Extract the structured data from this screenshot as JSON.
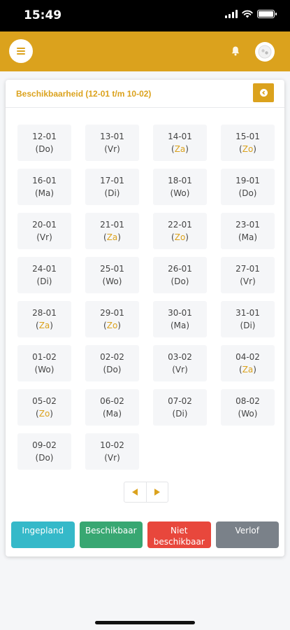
{
  "status_bar": {
    "time": "15:49"
  },
  "header": {
    "menu_icon": "hamburger-icon",
    "bell_icon": "bell-icon",
    "avatar_icon": "avatar-icon"
  },
  "card": {
    "title": "Beschikbaarheid (12-01 t/m 10-02)",
    "collapse_icon": "chevron-left-circle-icon"
  },
  "days": [
    {
      "date": "12-01",
      "weekday": "Do",
      "weekend": false
    },
    {
      "date": "13-01",
      "weekday": "Vr",
      "weekend": false
    },
    {
      "date": "14-01",
      "weekday": "Za",
      "weekend": true
    },
    {
      "date": "15-01",
      "weekday": "Zo",
      "weekend": true
    },
    {
      "date": "16-01",
      "weekday": "Ma",
      "weekend": false
    },
    {
      "date": "17-01",
      "weekday": "Di",
      "weekend": false
    },
    {
      "date": "18-01",
      "weekday": "Wo",
      "weekend": false
    },
    {
      "date": "19-01",
      "weekday": "Do",
      "weekend": false
    },
    {
      "date": "20-01",
      "weekday": "Vr",
      "weekend": false
    },
    {
      "date": "21-01",
      "weekday": "Za",
      "weekend": true
    },
    {
      "date": "22-01",
      "weekday": "Zo",
      "weekend": true
    },
    {
      "date": "23-01",
      "weekday": "Ma",
      "weekend": false
    },
    {
      "date": "24-01",
      "weekday": "Di",
      "weekend": false
    },
    {
      "date": "25-01",
      "weekday": "Wo",
      "weekend": false
    },
    {
      "date": "26-01",
      "weekday": "Do",
      "weekend": false
    },
    {
      "date": "27-01",
      "weekday": "Vr",
      "weekend": false
    },
    {
      "date": "28-01",
      "weekday": "Za",
      "weekend": true
    },
    {
      "date": "29-01",
      "weekday": "Zo",
      "weekend": true
    },
    {
      "date": "30-01",
      "weekday": "Ma",
      "weekend": false
    },
    {
      "date": "31-01",
      "weekday": "Di",
      "weekend": false
    },
    {
      "date": "01-02",
      "weekday": "Wo",
      "weekend": false
    },
    {
      "date": "02-02",
      "weekday": "Do",
      "weekend": false
    },
    {
      "date": "03-02",
      "weekday": "Vr",
      "weekend": false
    },
    {
      "date": "04-02",
      "weekday": "Za",
      "weekend": true
    },
    {
      "date": "05-02",
      "weekday": "Zo",
      "weekend": true
    },
    {
      "date": "06-02",
      "weekday": "Ma",
      "weekend": false
    },
    {
      "date": "07-02",
      "weekday": "Di",
      "weekend": false
    },
    {
      "date": "08-02",
      "weekday": "Wo",
      "weekend": false
    },
    {
      "date": "09-02",
      "weekday": "Do",
      "weekend": false
    },
    {
      "date": "10-02",
      "weekday": "Vr",
      "weekend": false
    }
  ],
  "pager": {
    "prev_icon": "triangle-left-icon",
    "next_icon": "triangle-right-icon"
  },
  "legend": [
    {
      "label": "Ingepland",
      "color": "#35b9c9"
    },
    {
      "label": "Beschikbaar",
      "color": "#38a772"
    },
    {
      "label": "Niet beschikbaar",
      "color": "#e8473c"
    },
    {
      "label": "Verlof",
      "color": "#7a8189"
    }
  ],
  "colors": {
    "accent": "#dba21d"
  }
}
